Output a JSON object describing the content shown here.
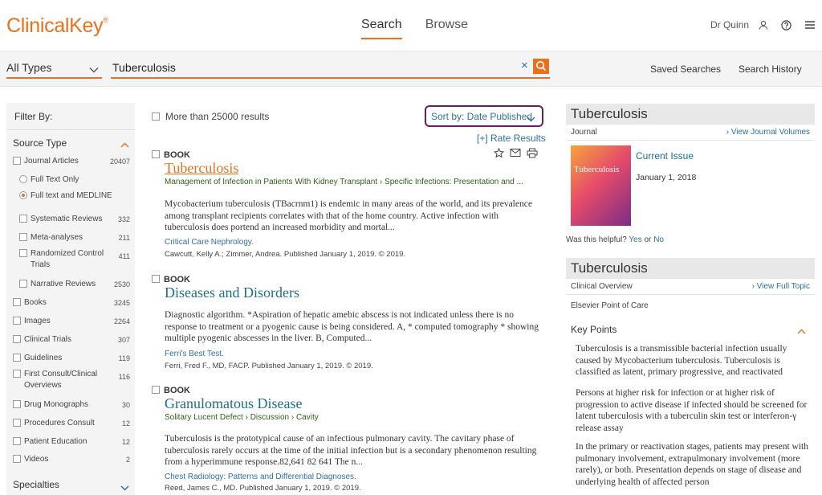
{
  "header": {
    "logo": "ClinicalKey",
    "logo_mark": "®",
    "nav": [
      "Search",
      "Browse"
    ],
    "user": "Dr Quinn"
  },
  "searchbar": {
    "type": "All Types",
    "query": "Tuberculosis",
    "clear": "×",
    "saved_searches": "Saved Searches",
    "search_history": "Search History"
  },
  "filter": {
    "title": "Filter By:",
    "source_type": "Source Type",
    "items": [
      {
        "label": "Journal Articles",
        "count": "20407"
      },
      {
        "label": "Full Text Only",
        "count": ""
      },
      {
        "label": "Full text and MEDLINE",
        "count": ""
      },
      {
        "label": "Systematic Reviews",
        "count": "332"
      },
      {
        "label": "Meta-analyses",
        "count": "211"
      },
      {
        "label": "Randomized Control",
        "label2": "Trials",
        "count": "411"
      },
      {
        "label": "Narrative Reviews",
        "count": "2530"
      },
      {
        "label": "Books",
        "count": "3245"
      },
      {
        "label": "Images",
        "count": "2264"
      },
      {
        "label": "Clinical Trials",
        "count": "307"
      },
      {
        "label": "Guidelines",
        "count": "119"
      },
      {
        "label": "First Consult/Clinical",
        "label2": "Overviews",
        "count": "116"
      },
      {
        "label": "Drug Monographs",
        "count": "30"
      },
      {
        "label": "Procedures Consult",
        "count": "12"
      },
      {
        "label": "Patient Education",
        "count": "12"
      },
      {
        "label": "Videos",
        "count": "2"
      }
    ],
    "specialties": "Specialties"
  },
  "results": {
    "count_label": "More than 25000 results",
    "sort": "Sort by: Date Published",
    "rate": "[+] Rate Results",
    "items": [
      {
        "type": "BOOK",
        "title": "Tuberculosis",
        "breadcrumb": "Management of Infection in Patients With Kidney Transplant  ›  Specific Infections: Presentation and ...",
        "desc": "Mycobacterium tuberculosis (TBacrnm1) is endemic in many areas of the world, and its prevalence among transplant recipients correlates with that of the home country. Active infection with tuberculosis does portend an increased morbidity and mortal...",
        "source": "Critical Care Nephrology.",
        "meta": "Cawcutt, Kelly A.; Zimmer, Andrea. Published January 1, 2019. © 2019."
      },
      {
        "type": "BOOK",
        "title": "Diseases and Disorders",
        "breadcrumb": "",
        "desc": "Diagnostic algorithm. *Aspiration of hepatic amebic abscess is not indicated unless there is no response to treatment or a pyogenic cause is being considered. A, * computed tomography * showing multiple pyogenic abscesses in the liver. B, Computed...",
        "source": "Ferri's Best Test.",
        "meta": "Ferri, Fred F., MD, FACP. Published January 1, 2019. © 2019."
      },
      {
        "type": "BOOK",
        "title": "Granulomatous Disease",
        "breadcrumb": "Solitary Lucent Defect  ›  Discussion  ›  Cavity",
        "desc": "Tuberculosis is the prototypical cause of an infectious pulmonary cavity. The cavitary phase of tuberculosis rarely occurs at the time of the initial infection but is a secondary phenomenon resulting from a hyperimmune response.82,641 82 641 The n...",
        "source": "Chest Radiology: Patterns and Differential Diagnoses.",
        "meta": "Reed, James C., MD. Published January 1, 2019. © 2019."
      }
    ]
  },
  "journal_panel": {
    "title": "Tuberculosis",
    "sub": "Journal",
    "link": "View Journal Volumes",
    "cover_text": "Tuberculosis",
    "current_issue": "Current Issue",
    "date": "January 1, 2018",
    "helpful": "Was this helpful?",
    "yes": "Yes",
    "or": "or",
    "no": "No"
  },
  "overview_panel": {
    "title": "Tuberculosis",
    "sub": "Clinical Overview",
    "link": "View Full Topic",
    "source": "Elsevier Point of Care",
    "key_points": "Key Points",
    "kp": [
      "Tuberculosis is a transmissible bacterial infection usually caused by Mycobacterium tuberculosis. Tuberculosis is classified as latent, primary progressive, and reactivated",
      "Persons at higher risk for infection or at higher risk of progression to active disease if infected should be screened for latent tuberculosis with a tuberculin skin test or interferon-γ release assay",
      "In the primary or reactivation stages, patients may present with pulmonary involvement, extrapulmonary involvement (more rarely), or both. Presentation depends on stage of disease and underlying health of affected person"
    ]
  },
  "colors": {
    "accent": "#e9711c",
    "link": "#2e6fa2",
    "title": "#1f6d8c",
    "sort_border": "#6d1a5f"
  }
}
